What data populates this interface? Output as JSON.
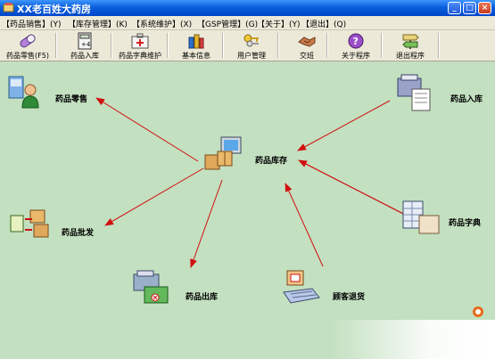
{
  "window": {
    "title": "XX老百姓大药房"
  },
  "menu": [
    "【药品销售】(Y)",
    "【库存管理】(K)",
    "【系统维护】(X)",
    "【GSP管理】(G)",
    "【关于】(Y)",
    "【退出】(Q)"
  ],
  "toolbar": [
    {
      "label": "药品零售(F5)",
      "icon": "pill-icon"
    },
    {
      "label": "药品入库",
      "icon": "calculator-icon"
    },
    {
      "label": "药品字典维护",
      "icon": "medical-kit-icon"
    },
    {
      "label": "基本信息",
      "icon": "bottles-icon"
    },
    {
      "label": "用户管理",
      "icon": "keys-icon"
    },
    {
      "label": "交班",
      "icon": "handshake-icon"
    },
    {
      "label": "关于程序",
      "icon": "help-icon"
    },
    {
      "label": "退出程序",
      "icon": "exit-sign-icon"
    }
  ],
  "diagram": {
    "center": "药品库存",
    "retail": "药品零售",
    "stock_in": "药品入库",
    "wholesale": "药品批发",
    "dictionary": "药品字典",
    "stock_out": "药品出库",
    "customer_return": "顾客退货"
  },
  "colors": {
    "arrow": "#d01010",
    "canvas": "#c3e0c0",
    "titlebar": "#0a5fdc"
  }
}
